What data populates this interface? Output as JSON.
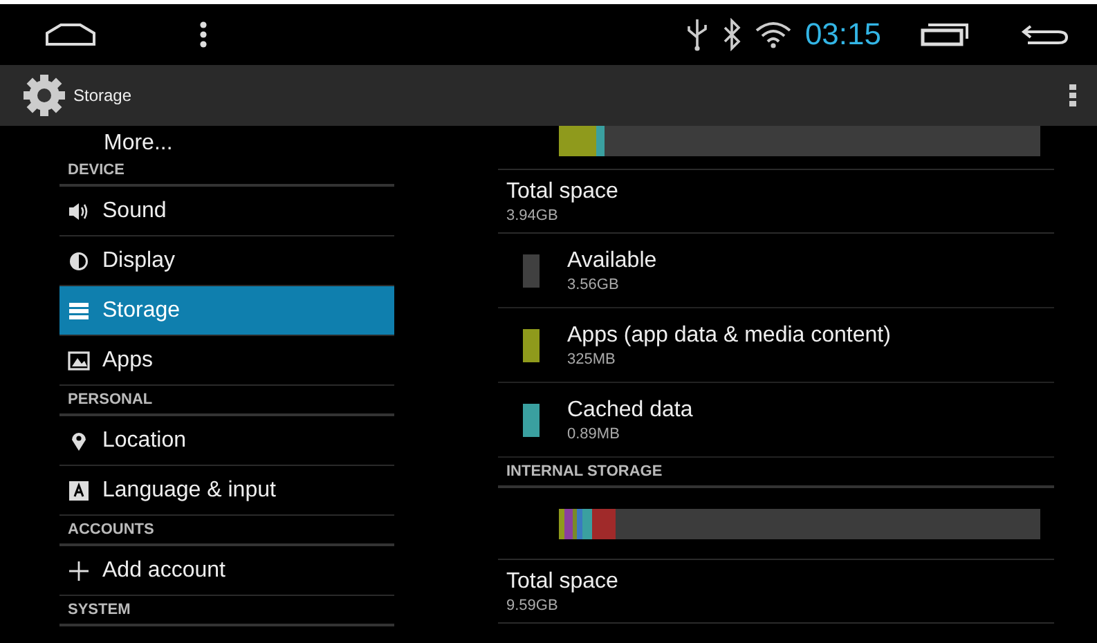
{
  "status_bar": {
    "time": "03:15"
  },
  "action_bar": {
    "title": "Storage"
  },
  "sidebar": {
    "items": [
      {
        "kind": "item",
        "label": "More...",
        "selected": false
      },
      {
        "kind": "header",
        "label": "DEVICE"
      },
      {
        "kind": "item",
        "label": "Sound",
        "selected": false
      },
      {
        "kind": "item",
        "label": "Display",
        "selected": false
      },
      {
        "kind": "item",
        "label": "Storage",
        "selected": true
      },
      {
        "kind": "item",
        "label": "Apps",
        "selected": false
      },
      {
        "kind": "header",
        "label": "PERSONAL"
      },
      {
        "kind": "item",
        "label": "Location",
        "selected": false
      },
      {
        "kind": "item",
        "label": "Language & input",
        "selected": false
      },
      {
        "kind": "header",
        "label": "ACCOUNTS"
      },
      {
        "kind": "item",
        "label": "Add account",
        "selected": false
      },
      {
        "kind": "header",
        "label": "SYSTEM"
      }
    ]
  },
  "storage": {
    "rows": [
      {
        "kind": "bar"
      },
      {
        "kind": "total",
        "label": "Total space",
        "value": "3.94GB"
      },
      {
        "kind": "legend",
        "label": "Available",
        "value": "3.56GB",
        "color": "#404040"
      },
      {
        "kind": "legend",
        "label": "Apps (app data & media content)",
        "value": "325MB",
        "color": "#8f9a1c"
      },
      {
        "kind": "legend",
        "label": "Cached data",
        "value": "0.89MB",
        "color": "#3aa0a0"
      },
      {
        "kind": "header",
        "label": "INTERNAL STORAGE"
      },
      {
        "kind": "bar"
      },
      {
        "kind": "total",
        "label": "Total space",
        "value": "9.59GB"
      }
    ]
  }
}
